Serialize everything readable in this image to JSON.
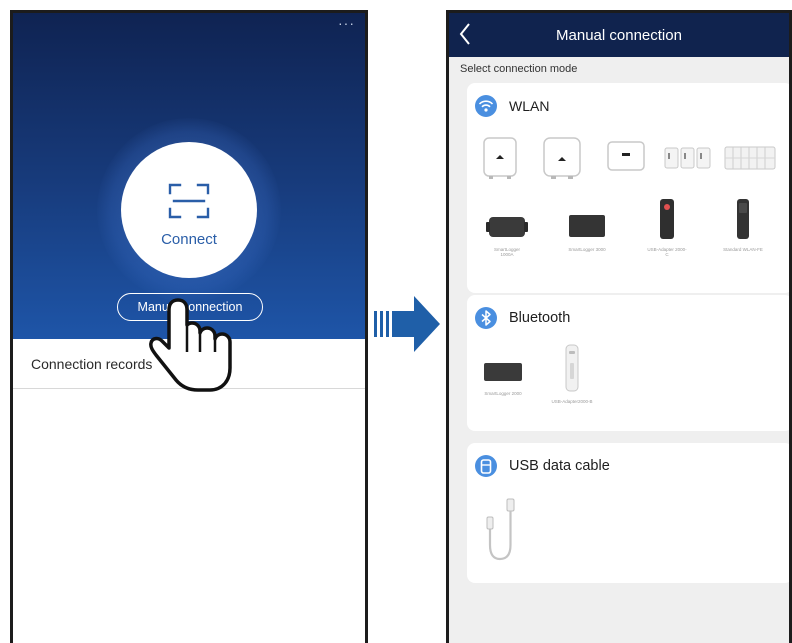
{
  "left_screen": {
    "more_menu": "···",
    "connect_label": "Connect",
    "manual_button_label": "Manual connection",
    "connection_records_label": "Connection records"
  },
  "right_screen": {
    "title": "Manual connection",
    "section_label": "Select connection mode",
    "wlan": {
      "title": "WLAN",
      "devices": [
        {
          "caption": ""
        },
        {
          "caption": ""
        },
        {
          "caption": ""
        },
        {
          "caption": ""
        },
        {
          "caption": ""
        },
        {
          "caption": "SmartLogger 1000A"
        },
        {
          "caption": "SmartLogger 3000"
        },
        {
          "caption": "USB-Adapter 2000-C"
        },
        {
          "caption": "Standard WLAN-FE"
        }
      ]
    },
    "bluetooth": {
      "title": "Bluetooth",
      "devices": [
        {
          "caption": "SmartLogger 2000"
        },
        {
          "caption": "USB-Adapter2000-B"
        }
      ]
    },
    "usb": {
      "title": "USB data cable"
    }
  },
  "colors": {
    "hero_dark": "#0f2352",
    "hero_light": "#1e55a8",
    "topbar": "#10234e",
    "accent_blue": "#2a5ea8",
    "arrow_blue": "#1f5fa8"
  },
  "icons": {
    "scan": "scan-frame-icon",
    "wifi": "wifi-icon",
    "bluetooth": "bluetooth-icon",
    "usb": "usb-icon",
    "back": "chevron-left-icon",
    "pointer": "hand-pointer-icon",
    "transition": "right-arrow-icon"
  }
}
